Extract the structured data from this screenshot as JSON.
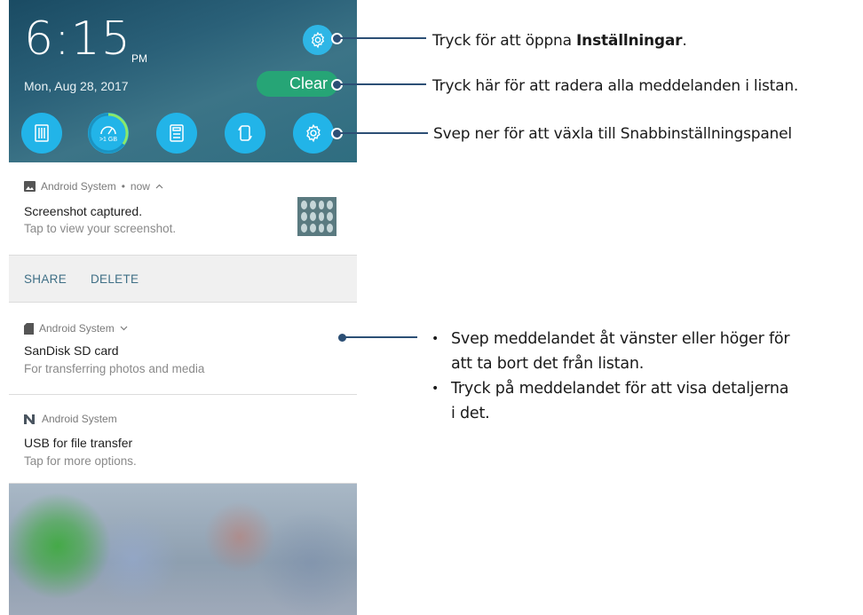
{
  "status": {
    "time": "6:15",
    "ampm": "PM",
    "date": "Mon, Aug 28, 2017"
  },
  "header": {
    "clear_label": "Clear"
  },
  "quick_settings": {
    "buttons": [
      {
        "icon": "asus-logo-icon"
      },
      {
        "icon": "booster-icon",
        "label": ">1 GB",
        "ring_fraction": 0.35
      },
      {
        "icon": "calculator-icon"
      },
      {
        "icon": "rotate-icon"
      },
      {
        "icon": "settings-icon"
      }
    ]
  },
  "notifications": [
    {
      "app": "Android System",
      "time": "now",
      "title": "Screenshot captured.",
      "text": "Tap to view your screenshot.",
      "actions": [
        "SHARE",
        "DELETE"
      ]
    },
    {
      "app": "Android System",
      "title": "SanDisk SD card",
      "text": "For transferring photos and media"
    },
    {
      "app": "Android System",
      "title": "USB for file transfer",
      "text": "Tap for more options."
    }
  ],
  "callouts": {
    "settings_prefix": "Tryck för att öppna ",
    "settings_bold": "Inställningar",
    "settings_suffix": ".",
    "clear": "Tryck här för att radera alla meddelanden i listan.",
    "quick": "Svep ner för att växla till Snabbinställningspanel",
    "bullet1_line1": "Svep meddelandet åt vänster eller höger för",
    "bullet1_line2": "att ta bort det från listan.",
    "bullet2_line1": "Tryck på meddelandet för att visa detaljerna",
    "bullet2_line2": "i det."
  },
  "colors": {
    "accent": "#22b4e8",
    "clear_button": "#26a576",
    "callout_line": "#2c4f75",
    "action_text": "#3f6f86"
  }
}
